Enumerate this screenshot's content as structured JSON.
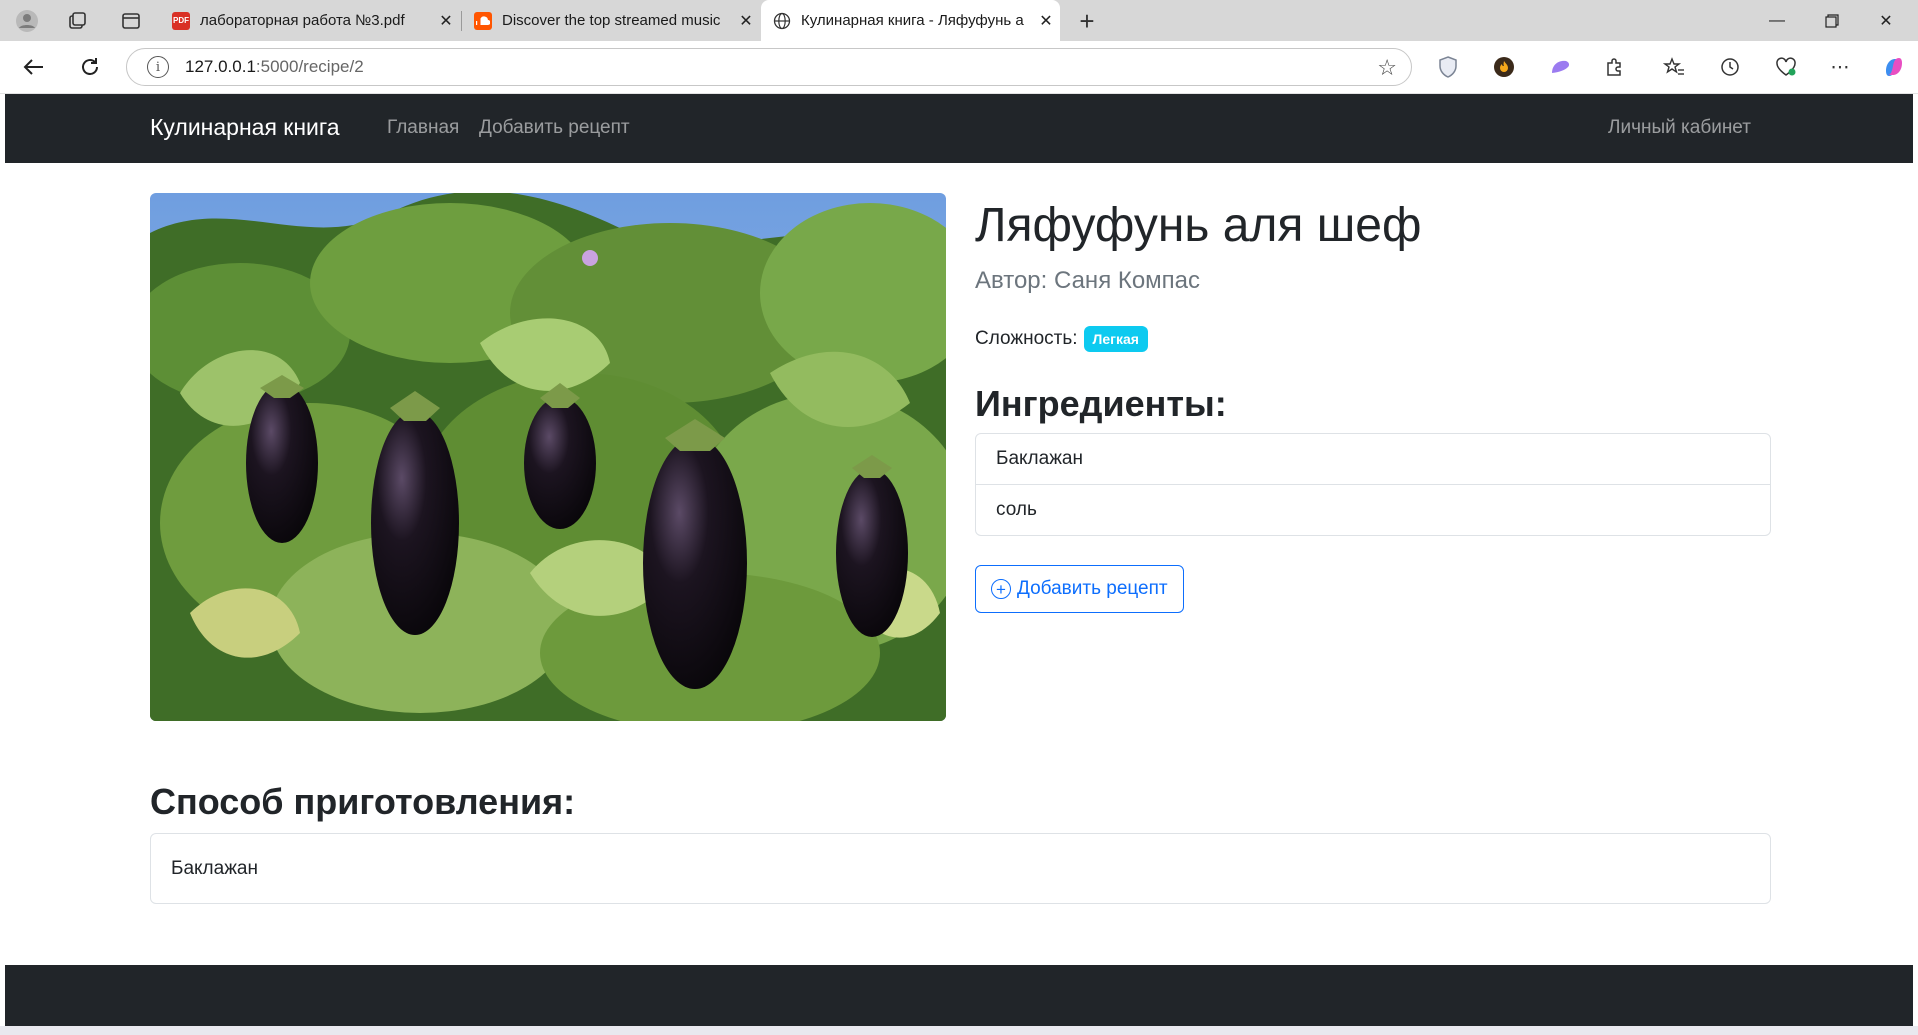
{
  "browser": {
    "tabs": [
      {
        "title": "лабораторная работа №3.pdf",
        "favicon": "pdf-icon",
        "active": false
      },
      {
        "title": "Discover the top streamed music",
        "favicon": "soundcloud-icon",
        "active": false
      },
      {
        "title": "Кулинарная книга - Ляфуфунь а",
        "favicon": "globe-icon",
        "active": true
      }
    ],
    "url_host": "127.0.0.1",
    "url_path": ":5000/recipe/2"
  },
  "navbar": {
    "brand": "Кулинарная книга",
    "links": [
      "Главная",
      "Добавить рецепт"
    ],
    "account": "Личный кабинет"
  },
  "recipe": {
    "title": "Ляфуфунь аля шеф",
    "author": "Автор: Саня Компас",
    "difficulty_label": "Сложность:",
    "difficulty": "Легкая",
    "ingredients_heading": "Ингредиенты:",
    "ingredients": [
      "Баклажан",
      "соль"
    ],
    "add_button": "Добавить рецепт",
    "method_heading": "Способ приготовления:",
    "method": "Баклажан"
  },
  "colors": {
    "navbar_bg": "#212529",
    "badge_info": "#0dcaf0",
    "primary": "#0d6efd"
  }
}
